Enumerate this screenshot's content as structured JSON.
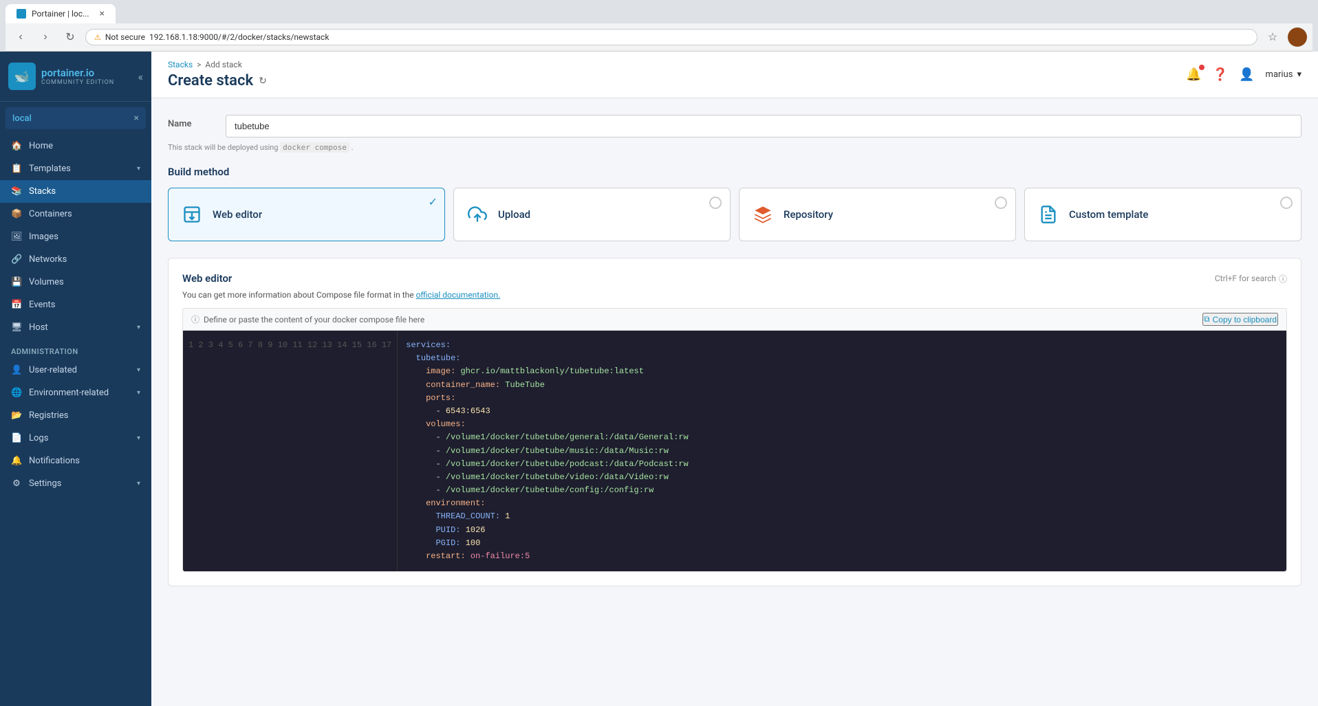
{
  "browser": {
    "tab_title": "Portainer | loc...",
    "address": "192.168.1.18:9000/#/2/docker/stacks/newstack",
    "is_secure": false,
    "security_label": "Not secure"
  },
  "sidebar": {
    "logo": {
      "main": "portainer.io",
      "sub": "COMMUNITY EDITION"
    },
    "environment": {
      "name": "local",
      "close_label": "×"
    },
    "nav_items": [
      {
        "id": "home",
        "label": "Home",
        "icon": "🏠"
      },
      {
        "id": "templates",
        "label": "Templates",
        "icon": "📋",
        "has_chevron": true
      },
      {
        "id": "stacks",
        "label": "Stacks",
        "icon": "📚",
        "active": true
      },
      {
        "id": "containers",
        "label": "Containers",
        "icon": "📦"
      },
      {
        "id": "images",
        "label": "Images",
        "icon": "🖼"
      },
      {
        "id": "networks",
        "label": "Networks",
        "icon": "🔗"
      },
      {
        "id": "volumes",
        "label": "Volumes",
        "icon": "💾"
      },
      {
        "id": "events",
        "label": "Events",
        "icon": "📅"
      },
      {
        "id": "host",
        "label": "Host",
        "icon": "🖥",
        "has_chevron": true
      }
    ],
    "admin_section": "Administration",
    "admin_items": [
      {
        "id": "user-related",
        "label": "User-related",
        "icon": "👤",
        "has_chevron": true
      },
      {
        "id": "environment-related",
        "label": "Environment-related",
        "icon": "🌐",
        "has_chevron": true
      },
      {
        "id": "registries",
        "label": "Registries",
        "icon": "📂"
      },
      {
        "id": "logs",
        "label": "Logs",
        "icon": "📄",
        "has_chevron": true
      },
      {
        "id": "notifications",
        "label": "Notifications",
        "icon": "🔔"
      },
      {
        "id": "settings",
        "label": "Settings",
        "icon": "⚙",
        "has_chevron": true
      }
    ]
  },
  "header": {
    "breadcrumb_stacks": "Stacks",
    "breadcrumb_sep": ">",
    "breadcrumb_current": "Add stack",
    "page_title": "Create stack",
    "user_name": "marius"
  },
  "form": {
    "name_label": "Name",
    "name_value": "tubetube",
    "name_placeholder": "",
    "stack_hint": "This stack will be deployed using",
    "stack_tool": "docker compose",
    "stack_hint_suffix": ".",
    "build_method_title": "Build method",
    "build_methods": [
      {
        "id": "web-editor",
        "label": "Web editor",
        "selected": true
      },
      {
        "id": "upload",
        "label": "Upload",
        "selected": false
      },
      {
        "id": "repository",
        "label": "Repository",
        "selected": false
      },
      {
        "id": "custom-template",
        "label": "Custom template",
        "selected": false
      }
    ],
    "web_editor_title": "Web editor",
    "ctrl_f_hint": "Ctrl+F for search",
    "editor_hint": "You can get more information about Compose file format in the",
    "editor_hint_link": "official documentation.",
    "editor_define_hint": "Define or paste the content of your docker compose file here",
    "copy_clipboard": "Copy to clipboard",
    "code_lines": [
      {
        "num": 1,
        "content": "services:"
      },
      {
        "num": 2,
        "content": "  tubetube:"
      },
      {
        "num": 3,
        "content": "    image: ghcr.io/mattblackonly/tubetube:latest"
      },
      {
        "num": 4,
        "content": "    container_name: TubeTube"
      },
      {
        "num": 5,
        "content": "    ports:"
      },
      {
        "num": 6,
        "content": "      - 6543:6543"
      },
      {
        "num": 7,
        "content": "    volumes:"
      },
      {
        "num": 8,
        "content": "      - /volume1/docker/tubetube/general:/data/General:rw"
      },
      {
        "num": 9,
        "content": "      - /volume1/docker/tubetube/music:/data/Music:rw"
      },
      {
        "num": 10,
        "content": "      - /volume1/docker/tubetube/podcast:/data/Podcast:rw"
      },
      {
        "num": 11,
        "content": "      - /volume1/docker/tubetube/video:/data/Video:rw"
      },
      {
        "num": 12,
        "content": "      - /volume1/docker/tubetube/config:/config:rw"
      },
      {
        "num": 13,
        "content": "    environment:"
      },
      {
        "num": 14,
        "content": "      THREAD_COUNT: 1"
      },
      {
        "num": 15,
        "content": "      PUID: 1026"
      },
      {
        "num": 16,
        "content": "      PGID: 100"
      },
      {
        "num": 17,
        "content": "    restart: on-failure:5"
      }
    ]
  }
}
